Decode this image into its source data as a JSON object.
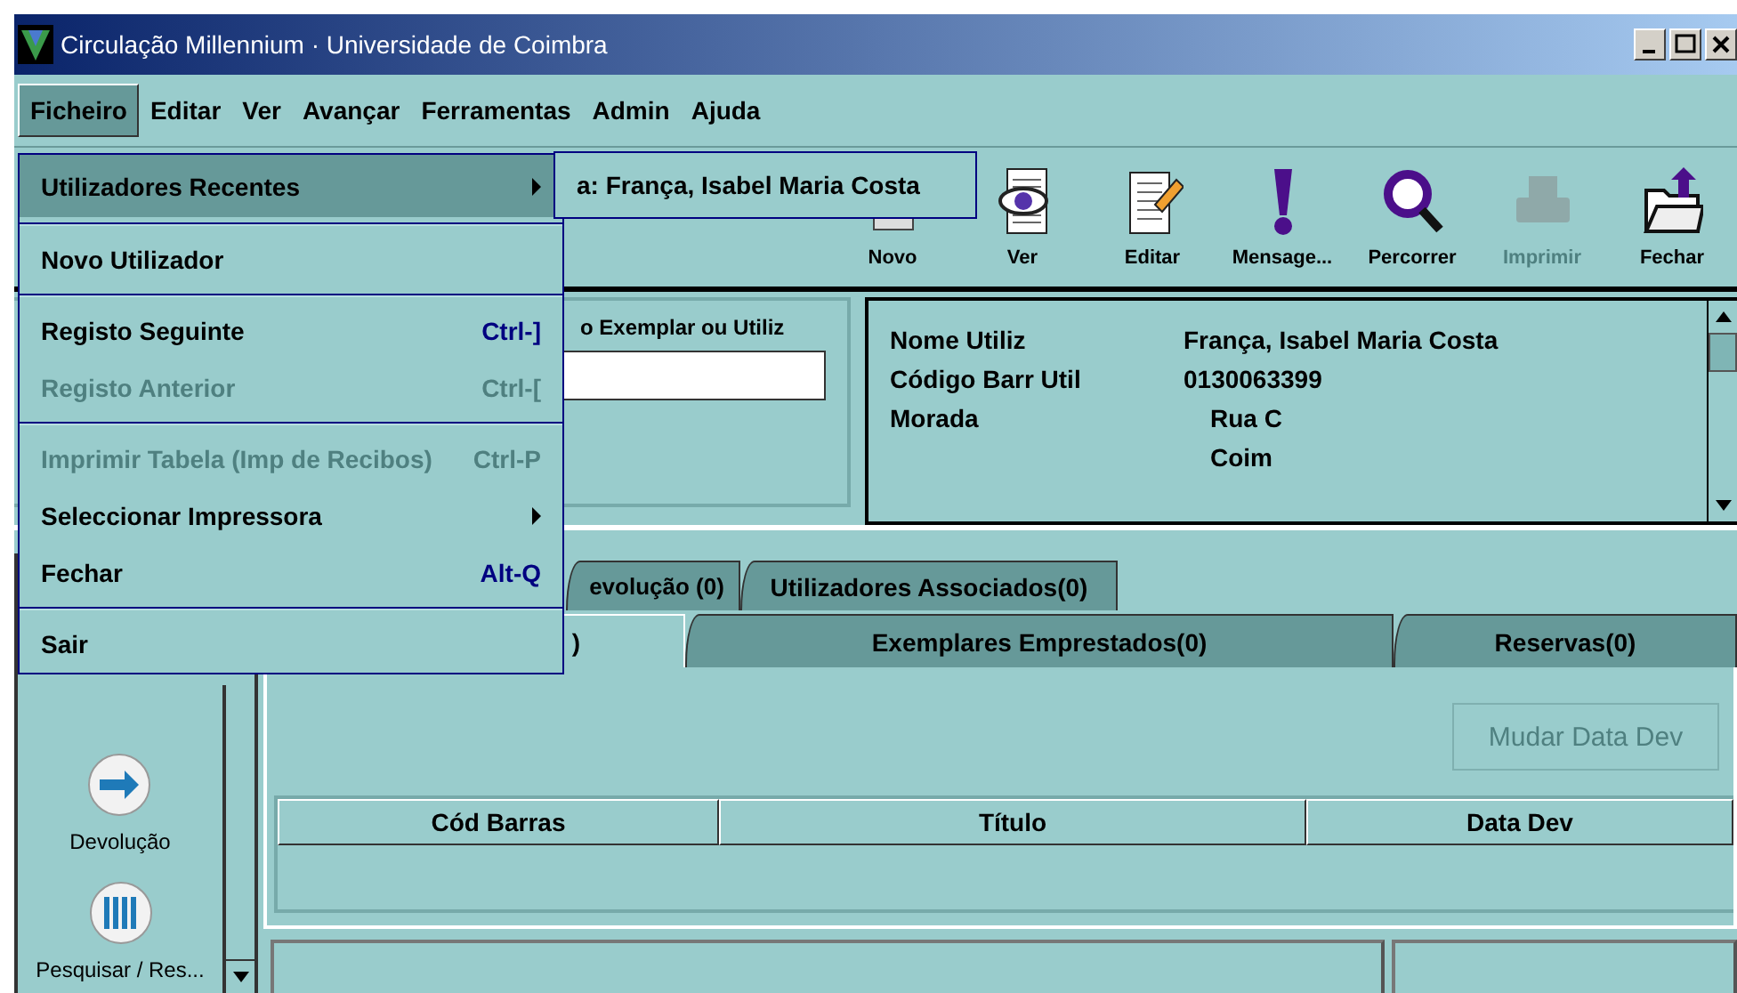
{
  "window": {
    "title": "Circulação Millennium · Universidade de Coimbra"
  },
  "menu_bar": [
    {
      "label": "Ficheiro",
      "selected": true
    },
    {
      "label": "Editar",
      "selected": false
    },
    {
      "label": "Ver",
      "selected": false
    },
    {
      "label": "Avançar",
      "selected": false
    },
    {
      "label": "Ferramentas",
      "selected": false
    },
    {
      "label": "Admin",
      "selected": false
    },
    {
      "label": "Ajuda",
      "selected": false
    }
  ],
  "file_menu": [
    {
      "kind": "submenu",
      "label": "Utilizadores Recentes",
      "selected": true,
      "disabled": false
    },
    {
      "kind": "separator"
    },
    {
      "kind": "item",
      "label": "Novo Utilizador",
      "selected": false,
      "disabled": false
    },
    {
      "kind": "separator"
    },
    {
      "kind": "item",
      "label": "Registo Seguinte",
      "shortcut": "Ctrl-]",
      "selected": false,
      "disabled": false
    },
    {
      "kind": "item",
      "label": "Registo Anterior",
      "shortcut": "Ctrl-[",
      "selected": false,
      "disabled": true
    },
    {
      "kind": "separator"
    },
    {
      "kind": "item",
      "label": "Imprimir Tabela (Imp de Recibos)",
      "shortcut": "Ctrl-P",
      "selected": false,
      "disabled": true
    },
    {
      "kind": "submenu",
      "label": "Seleccionar Impressora",
      "selected": false,
      "disabled": false
    },
    {
      "kind": "item",
      "label": "Fechar",
      "shortcut": "Alt-Q",
      "selected": false,
      "disabled": false
    },
    {
      "kind": "separator"
    },
    {
      "kind": "item",
      "label": "Sair",
      "selected": false,
      "disabled": false
    }
  ],
  "recent_submenu": [
    "a: França, Isabel Maria Costa"
  ],
  "toolbar": [
    {
      "kind": "new",
      "label": "Novo",
      "disabled": false
    },
    {
      "kind": "view",
      "label": "Ver",
      "disabled": false
    },
    {
      "kind": "edit",
      "label": "Editar",
      "disabled": false
    },
    {
      "kind": "message",
      "label": "Mensage...",
      "disabled": false
    },
    {
      "kind": "browse",
      "label": "Percorrer",
      "disabled": false
    },
    {
      "kind": "print",
      "label": "Imprimir",
      "disabled": true
    },
    {
      "kind": "close",
      "label": "Fechar",
      "disabled": false
    }
  ],
  "search_panel": {
    "label": "o Exemplar ou Utiliz"
  },
  "user_info": [
    {
      "label": "Nome Utiliz",
      "values": [
        "França, Isabel Maria Costa"
      ],
      "indented": false
    },
    {
      "label": "Código Barr Util",
      "values": [
        "0130063399"
      ],
      "indented": false
    },
    {
      "label": "Morada",
      "values": [
        "Rua C",
        "Coim"
      ],
      "indented": true
    }
  ],
  "tabs_row_1": [
    {
      "label": "evolução (0)",
      "selected": false
    },
    {
      "label": "Utilizadores Associados(0)",
      "selected": false
    }
  ],
  "tabs_row_2": [
    {
      "label": ")",
      "selected": true
    },
    {
      "label": "Exemplares Emprestados(0)",
      "selected": false
    },
    {
      "label": "Reservas(0)",
      "selected": false
    }
  ],
  "action_button": {
    "label": "Mudar Data Dev",
    "disabled": true
  },
  "table": {
    "columns": [
      "Cód Barras",
      "Título",
      "Data Dev"
    ]
  },
  "side_panel": [
    {
      "kind": "return",
      "label": "Devolução"
    },
    {
      "kind": "search",
      "label": "Pesquisar / Res..."
    }
  ]
}
